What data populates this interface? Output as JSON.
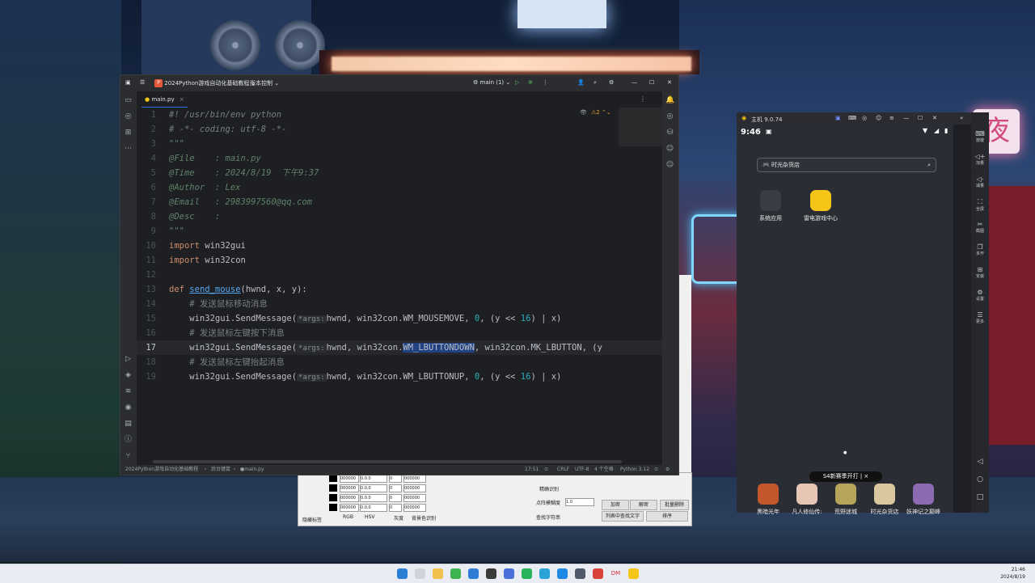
{
  "ide": {
    "project_name": "2024Python游戏自动化基础教程",
    "vcs": "版本控制",
    "run_config": "main (1)",
    "tab": "main.py",
    "inspection_count": "2",
    "line_numbers": [
      "1",
      "2",
      "3",
      "4",
      "5",
      "6",
      "7",
      "8",
      "9",
      "10",
      "11",
      "12",
      "13",
      "14",
      "15",
      "16",
      "17",
      "18",
      "19"
    ],
    "code": {
      "l1": "#! /usr/bin/env python",
      "l2": "# -*- coding: utf-8 -*-",
      "l3": "\"\"\"",
      "l4": "@File    : main.py",
      "l5": "@Time    : 2024/8/19  下午9:37",
      "l6": "@Author  : Lex",
      "l7": "@Email   : 2983997560@qq.com",
      "l8": "@Desc    :",
      "l9": "\"\"\"",
      "l10_kw": "import",
      "l10_rest": " win32gui",
      "l11_kw": "import",
      "l11_rest": " win32con",
      "l13_kw": "def ",
      "l13_fn": "send_mouse",
      "l13_rest": "(hwnd, x, y):",
      "l14": "    # 发送鼠标移动消息",
      "l15_a": "    win32gui.SendMessage(",
      "hint": "*args:",
      "l15_b": "hwnd, win32con.WM_MOUSEMOVE, ",
      "l15_n0": "0",
      "l15_c": ", (y << ",
      "l15_n16": "16",
      "l15_d": ") | x)",
      "l16": "    # 发送鼠标左键按下消息",
      "l17_a": "    win32gui.SendMessage(",
      "l17_b": "hwnd, win32con.",
      "l17_sel": "WM_LBUTTONDOWN",
      "l17_c": ", win32con.MK_LBUTTON, (y ",
      "l18": "    # 发送鼠标左键抬起消息",
      "l19_a": "    win32gui.SendMessage(",
      "l19_b": "hwnd, win32con.WM_LBUTTONUP, ",
      "l19_n0": "0",
      "l19_c": ", (y << ",
      "l19_n16": "16",
      "l19_d": ") | x)"
    },
    "status": {
      "breadcrumb_project": "2024Python游戏自动化基础教程",
      "breadcrumb_folder": "后台键鼠",
      "breadcrumb_file": "main.py",
      "position": "17:51",
      "line_sep": "CRLF",
      "encoding": "UTF-8",
      "indent": "4 个空格",
      "interpreter": "Python 3.12"
    }
  },
  "tool_window": {
    "fields": [
      "000000",
      "0.0.0",
      "0",
      "000000"
    ],
    "chk_hide": "隐藏标签",
    "radio_rgb": "RGB",
    "radio_hsv": "HSV",
    "radio_gray": "灰度",
    "chk_bg": "背景色识别",
    "precise": "精确识别",
    "similarity_label": "点阵模糊度",
    "similarity_value": "1.0",
    "find_char": "查找字符串",
    "btn_add": "加密",
    "btn_decrypt": "解密",
    "btn_batch": "批量删除",
    "btn_list": "列表中查找文字",
    "btn_sort": "排序"
  },
  "emulator": {
    "title": "主机 9.0.74",
    "time": "9:46",
    "search_text": "时光杂货店",
    "apps": [
      "系统应用",
      "雷电游戏中心"
    ],
    "promo": "S4新赛季开打",
    "dock": [
      "黑暗光年",
      "凡人修仙传:",
      "荒野迷城",
      "时光杂货店",
      "妖神记之巅峰"
    ],
    "side_buttons": [
      "按键",
      "加量",
      "减量",
      "全屏",
      "截图",
      "多开",
      "安装",
      "设置",
      "更多"
    ]
  },
  "wallpaper": {
    "sign": "夜"
  },
  "taskbar": {
    "time": "21:46",
    "date": "2024/8/19"
  }
}
